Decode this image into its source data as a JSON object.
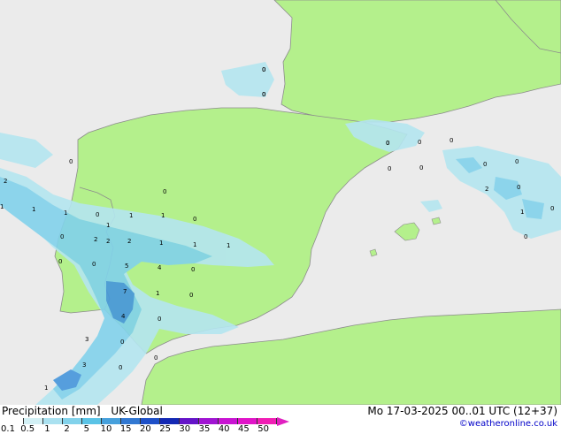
{
  "title": {
    "product": "Precipitation [mm]",
    "model": "UK-Global",
    "datetime": "Mo 17-03-2025 00..01 UTC (12+37)"
  },
  "credit": "©weatheronline.co.uk",
  "colors": {
    "sea": "#ebebeb",
    "land": "#b4f08c",
    "border": "#8c8c8c",
    "light_rain": "#b4e6f0",
    "moderate_rain": "#82d2eb",
    "heavy_rain": "#4696dc"
  },
  "legend": {
    "ticks": [
      "0.1",
      "0.5",
      "1",
      "2",
      "5",
      "10",
      "15",
      "20",
      "25",
      "30",
      "35",
      "40",
      "45",
      "50"
    ],
    "colors": [
      "#ffffff",
      "#d2f0f5",
      "#aae1f0",
      "#82d2eb",
      "#5ac3e6",
      "#46a0dc",
      "#3278d2",
      "#1e50c8",
      "#1428b4",
      "#6414c8",
      "#a014d2",
      "#c814d2",
      "#e014c8",
      "#f01eb4"
    ]
  },
  "points": [
    {
      "v": "0"
    },
    {
      "v": "0"
    },
    {
      "v": "0"
    },
    {
      "v": "0"
    },
    {
      "v": "0"
    },
    {
      "v": "0"
    },
    {
      "v": "0"
    },
    {
      "v": "2"
    },
    {
      "v": "1"
    },
    {
      "v": "0"
    },
    {
      "v": "1"
    },
    {
      "v": "1"
    },
    {
      "v": "0"
    },
    {
      "v": "2"
    },
    {
      "v": "0"
    },
    {
      "v": "1"
    },
    {
      "v": "0"
    },
    {
      "v": "1"
    },
    {
      "v": "0"
    },
    {
      "v": "2"
    },
    {
      "v": "2"
    },
    {
      "v": "1"
    },
    {
      "v": "1"
    },
    {
      "v": "1"
    },
    {
      "v": "0"
    },
    {
      "v": "0"
    },
    {
      "v": "5"
    },
    {
      "v": "4"
    },
    {
      "v": "0"
    },
    {
      "v": "7"
    },
    {
      "v": "1"
    },
    {
      "v": "0"
    },
    {
      "v": "0"
    },
    {
      "v": "4"
    },
    {
      "v": "0"
    },
    {
      "v": "3"
    },
    {
      "v": "0"
    },
    {
      "v": "3"
    },
    {
      "v": "0"
    },
    {
      "v": "1"
    },
    {
      "v": "0"
    },
    {
      "v": "0"
    },
    {
      "v": "0"
    },
    {
      "v": "0"
    },
    {
      "v": "2"
    },
    {
      "v": "0"
    },
    {
      "v": "1"
    },
    {
      "v": "1"
    },
    {
      "v": "0"
    },
    {
      "v": "0"
    },
    {
      "v": "0"
    }
  ]
}
